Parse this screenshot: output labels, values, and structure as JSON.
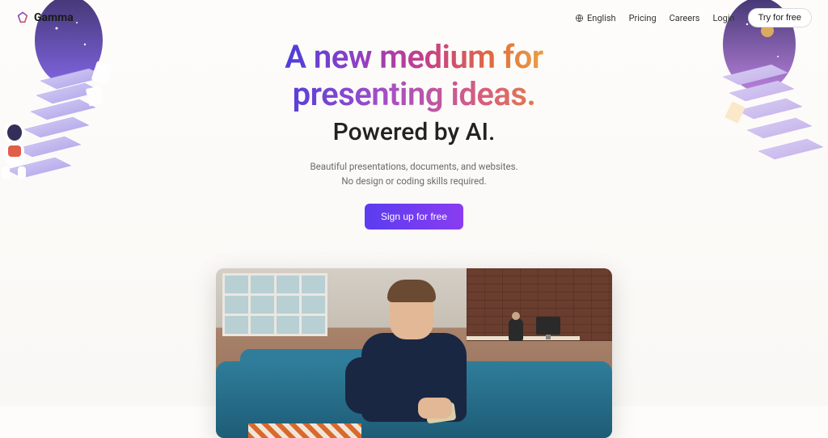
{
  "brand": "Gamma",
  "nav": {
    "language": "English",
    "links": [
      "Pricing",
      "Careers",
      "Login"
    ],
    "cta": "Try for free"
  },
  "hero": {
    "headline_line1": "A new medium for",
    "headline_line2": "presenting ideas.",
    "subheadline": "Powered by AI.",
    "description_line1": "Beautiful presentations, documents, and websites.",
    "description_line2": "No design or coding skills required.",
    "cta": "Sign up for free"
  }
}
